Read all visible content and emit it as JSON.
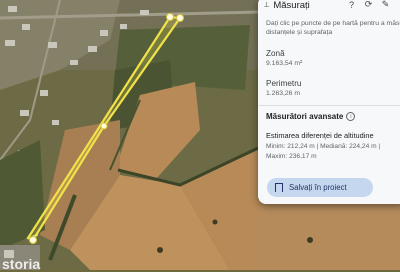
{
  "panel": {
    "title": "Măsurați",
    "help_line1": "Dați clic pe puncte de pe hartă pentru a măsura",
    "help_line2": "distanțele și suprafața",
    "icons": [
      "help-icon",
      "refresh-icon",
      "edit-icon",
      "close-icon"
    ]
  },
  "area": {
    "label": "Zonă",
    "value": "9.163,54 m²"
  },
  "perimeter": {
    "label": "Perimetru",
    "value": "1.263,26 m"
  },
  "advanced": {
    "label": "Măsurători avansate"
  },
  "elevation": {
    "label": "Estimarea diferenței de altitudine",
    "line1": "Minim: 212,24 m | Mediană: 224,24 m |",
    "line2": "Maxim: 236,17 m"
  },
  "save_button": {
    "label": "Salvați în proiect"
  },
  "watermark": {
    "text": "storia"
  },
  "colors": {
    "measure_line": "#f2e24a",
    "panel_bg": "#f7f8fa",
    "button_bg": "#c5d6ef"
  }
}
